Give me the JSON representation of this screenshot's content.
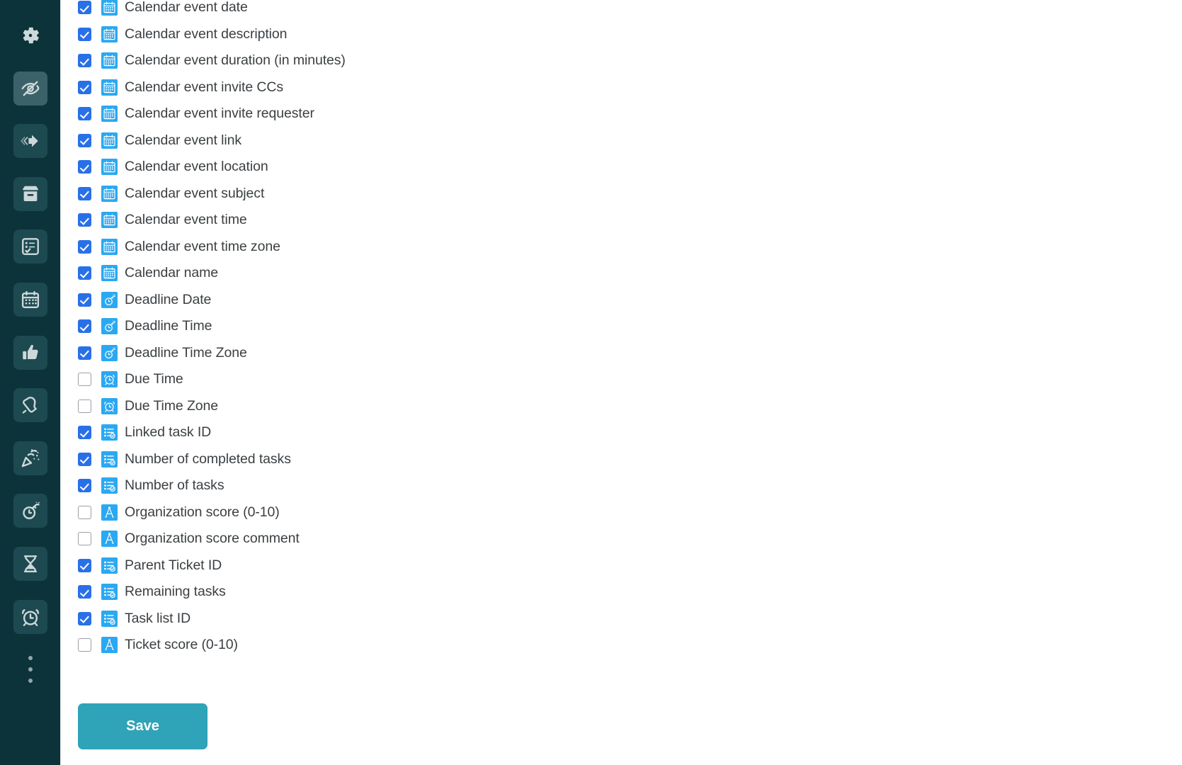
{
  "sidebar": {
    "background_color": "#0c3339",
    "items": [
      {
        "icon": "gear-icon",
        "name": "settings",
        "state": "plain"
      },
      {
        "icon": "eye-slash-icon",
        "name": "hidden-fields",
        "state": "active"
      },
      {
        "icon": "stack-arrow-icon",
        "name": "move-cards",
        "state": "tinted"
      },
      {
        "icon": "archive-box-icon",
        "name": "archive",
        "state": "tinted"
      },
      {
        "icon": "checklist-icon",
        "name": "checklists",
        "state": "tinted"
      },
      {
        "icon": "calendar-icon",
        "name": "calendar",
        "state": "tinted"
      },
      {
        "icon": "thumbs-up-icon",
        "name": "votes",
        "state": "tinted"
      },
      {
        "icon": "bell-icon",
        "name": "notifications",
        "state": "tinted"
      },
      {
        "icon": "party-popper-icon",
        "name": "celebrations",
        "state": "tinted"
      },
      {
        "icon": "bomb-icon",
        "name": "deadlines",
        "state": "tinted"
      },
      {
        "icon": "hourglass-icon",
        "name": "time-tracking",
        "state": "tinted"
      },
      {
        "icon": "alarm-clock-icon",
        "name": "reminders",
        "state": "tinted"
      },
      {
        "icon": "more-dots-icon",
        "name": "more-options",
        "state": "dots"
      }
    ]
  },
  "field_list": {
    "checked_color": "#2970e8",
    "icon_tile_color": "#2ba8f2",
    "rows": [
      {
        "label": "Calendar event date",
        "checked": true,
        "icon": "calendar-icon"
      },
      {
        "label": "Calendar event description",
        "checked": true,
        "icon": "calendar-icon"
      },
      {
        "label": "Calendar event duration (in minutes)",
        "checked": true,
        "icon": "calendar-icon"
      },
      {
        "label": "Calendar event invite CCs",
        "checked": true,
        "icon": "calendar-icon"
      },
      {
        "label": "Calendar event invite requester",
        "checked": true,
        "icon": "calendar-icon"
      },
      {
        "label": "Calendar event link",
        "checked": true,
        "icon": "calendar-icon"
      },
      {
        "label": "Calendar event location",
        "checked": true,
        "icon": "calendar-icon"
      },
      {
        "label": "Calendar event subject",
        "checked": true,
        "icon": "calendar-icon"
      },
      {
        "label": "Calendar event time",
        "checked": true,
        "icon": "calendar-icon"
      },
      {
        "label": "Calendar event time zone",
        "checked": true,
        "icon": "calendar-icon"
      },
      {
        "label": "Calendar name",
        "checked": true,
        "icon": "calendar-icon"
      },
      {
        "label": "Deadline Date",
        "checked": true,
        "icon": "bomb-icon"
      },
      {
        "label": "Deadline Time",
        "checked": true,
        "icon": "bomb-icon"
      },
      {
        "label": "Deadline Time Zone",
        "checked": true,
        "icon": "bomb-icon"
      },
      {
        "label": "Due Time",
        "checked": false,
        "icon": "alarm-clock-icon"
      },
      {
        "label": "Due Time Zone",
        "checked": false,
        "icon": "alarm-clock-icon"
      },
      {
        "label": "Linked task ID",
        "checked": true,
        "icon": "checklist-icon"
      },
      {
        "label": "Number of completed tasks",
        "checked": true,
        "icon": "checklist-icon"
      },
      {
        "label": "Number of tasks",
        "checked": true,
        "icon": "checklist-icon"
      },
      {
        "label": "Organization score (0-10)",
        "checked": false,
        "icon": "compass-icon"
      },
      {
        "label": "Organization score comment",
        "checked": false,
        "icon": "compass-icon"
      },
      {
        "label": "Parent Ticket ID",
        "checked": true,
        "icon": "checklist-icon"
      },
      {
        "label": "Remaining tasks",
        "checked": true,
        "icon": "checklist-icon"
      },
      {
        "label": "Task list ID",
        "checked": true,
        "icon": "checklist-icon"
      },
      {
        "label": "Ticket score (0-10)",
        "checked": false,
        "icon": "compass-icon"
      }
    ]
  },
  "actions": {
    "save_label": "Save",
    "save_color": "#2fa3b8"
  }
}
